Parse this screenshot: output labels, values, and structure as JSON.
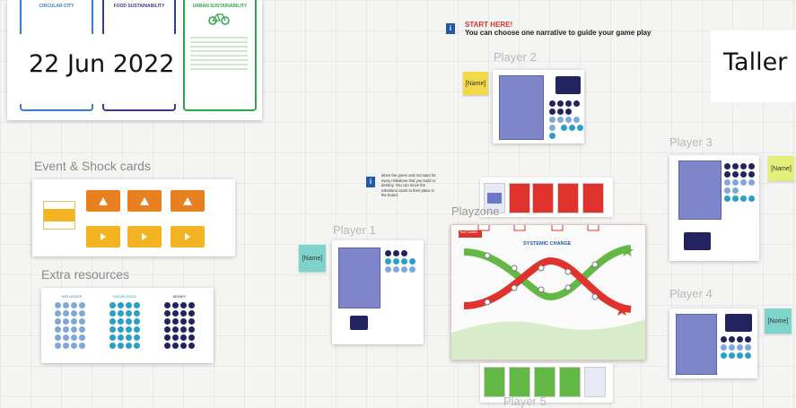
{
  "board": {
    "date_label": "22 Jun 2022",
    "taller_label": "Taller",
    "top_cards": [
      {
        "title": "CIRCULAR CITY",
        "color": "#3a7fc4"
      },
      {
        "title": "FOOD SUSTAINABILITY",
        "color": "#3b3b8f"
      },
      {
        "title": "URBAN SUSTAINABILITY",
        "color": "#2fa44f"
      }
    ]
  },
  "start": {
    "title": "START HERE!",
    "text": "You can choose one narrative to guide your game play"
  },
  "sections": {
    "events": "Event & Shock cards",
    "extra": "Extra resources",
    "playzone": "Playzone"
  },
  "players": {
    "p1": "Player 1",
    "p2": "Player 2",
    "p3": "Player 3",
    "p4": "Player 4",
    "p5": "Player 5"
  },
  "sticky_name": "[Name]",
  "sticky_p4": "[Nome]",
  "instructions": "Move the green and red stars for every milestone that you build or destroy. You can move the milestone cards to their place in the board.",
  "playzone_board": {
    "title": "SYSTEMIC CHANGE",
    "tag": "Your Context"
  },
  "extra_resources": {
    "columns": [
      "INFLUENCE",
      "KNOWLEDGE",
      "MONEY"
    ]
  },
  "colors": {
    "orange": "#e8801f",
    "yellow": "#f4b321",
    "sticky_yellow": "#f3d84a",
    "sticky_teal": "#7ed3cb",
    "sticky_lime": "#e4ef7a",
    "light_blue": "#5aa9dd",
    "navy": "#23235f",
    "red": "#e0332e",
    "green": "#64b946"
  }
}
